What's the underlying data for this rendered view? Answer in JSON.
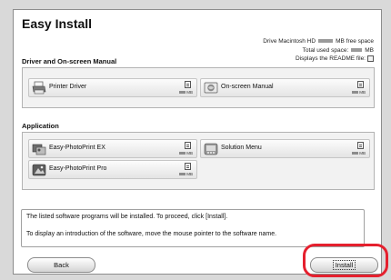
{
  "window": {
    "title": "Easy Install"
  },
  "info": {
    "drive_prefix": "Drive Macintosh HD",
    "drive_suffix": "MB free space",
    "total_prefix": "Total used space:",
    "total_suffix": "MB",
    "readme_text": "Displays the README file:"
  },
  "sections": {
    "driver_title": "Driver and On-screen Manual",
    "application_title": "Application"
  },
  "driver_items": [
    {
      "label": "Printer Driver",
      "size_unit": "MB",
      "icon": "printer-icon"
    },
    {
      "label": "On-screen Manual",
      "size_unit": "MB",
      "icon": "manual-icon"
    }
  ],
  "application_items": [
    {
      "label": "Easy-PhotoPrint EX",
      "size_unit": "MB",
      "icon": "easy-photoprint-ex-icon"
    },
    {
      "label": "Solution Menu",
      "size_unit": "MB",
      "icon": "solution-menu-icon"
    },
    {
      "label": "Easy-PhotoPrint Pro",
      "size_unit": "MB",
      "icon": "easy-photoprint-pro-icon"
    }
  ],
  "description": {
    "line1": "The listed software programs will be installed. To proceed, click [Install].",
    "line2": "To display an introduction of the software, move the mouse pointer to the software name."
  },
  "buttons": {
    "back": "Back",
    "install": "Install"
  },
  "colors": {
    "highlight": "#e5202e",
    "panel_bg": "#f2f2f2"
  }
}
